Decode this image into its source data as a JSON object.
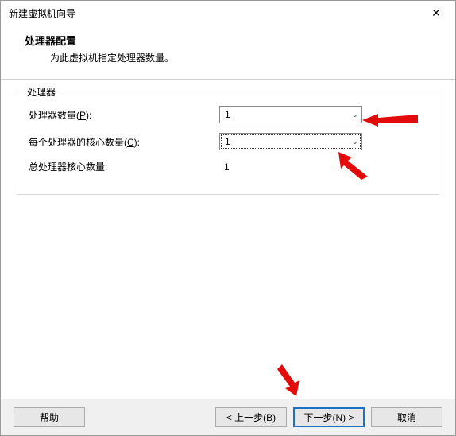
{
  "window": {
    "title": "新建虚拟机向导",
    "close": "✕"
  },
  "header": {
    "title": "处理器配置",
    "subtitle": "为此虚拟机指定处理器数量。"
  },
  "group": {
    "legend": "处理器",
    "processorCountLabelPrefix": "处理器数量(",
    "processorCountKey": "P",
    "processorCountLabelSuffix": "):",
    "processorCountValue": "1",
    "coresPerProcessorLabelPrefix": "每个处理器的核心数量(",
    "coresPerProcessorKey": "C",
    "coresPerProcessorLabelSuffix": "):",
    "coresPerProcessorValue": "1",
    "totalCoresLabel": "总处理器核心数量:",
    "totalCoresValue": "1"
  },
  "buttons": {
    "help": "帮助",
    "backPrefix": "< 上一步(",
    "backKey": "B",
    "backSuffix": ")",
    "nextPrefix": "下一步(",
    "nextKey": "N",
    "nextSuffix": ") >",
    "cancel": "取消"
  },
  "icons": {
    "chevron": "⌄"
  }
}
